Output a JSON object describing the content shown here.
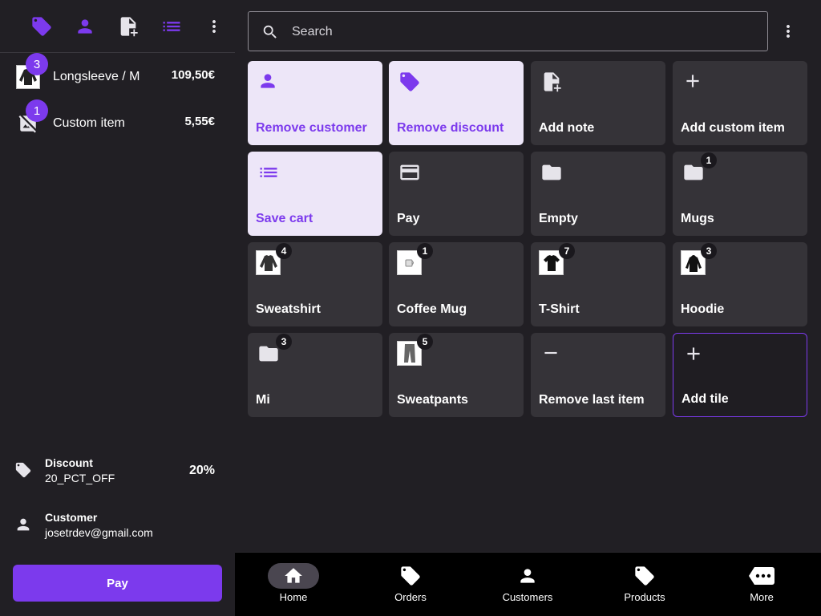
{
  "colors": {
    "accent": "#7c3aed",
    "tile": "#353338",
    "tile_light": "#ede6f8",
    "background": "#211f24"
  },
  "toolbar": {
    "icons": [
      "tag-icon",
      "person-icon",
      "note-add-icon",
      "list-icon",
      "more-vert-icon"
    ]
  },
  "cart": {
    "items": [
      {
        "name": "Longsleeve / M",
        "price": "109,50€",
        "qty": "3",
        "icon": "longsleeve-thumbnail"
      },
      {
        "name": "Custom item",
        "price": "5,55€",
        "qty": "1",
        "icon": "no-image-icon"
      }
    ],
    "discount": {
      "title": "Discount",
      "code": "20_PCT_OFF",
      "value": "20%"
    },
    "customer": {
      "title": "Customer",
      "email": "josetrdev@gmail.com"
    },
    "pay_label": "Pay"
  },
  "search": {
    "placeholder": "Search"
  },
  "tiles": [
    {
      "label": "Remove customer",
      "icon": "person-icon",
      "style": "light"
    },
    {
      "label": "Remove discount",
      "icon": "tag-icon",
      "style": "light"
    },
    {
      "label": "Add note",
      "icon": "note-add-icon",
      "style": "dark"
    },
    {
      "label": "Add custom item",
      "icon": "plus-icon",
      "style": "dark"
    },
    {
      "label": "Save cart",
      "icon": "list-icon",
      "style": "light"
    },
    {
      "label": "Pay",
      "icon": "credit-card-icon",
      "style": "dark"
    },
    {
      "label": "Empty",
      "icon": "folder-icon",
      "style": "dark"
    },
    {
      "label": "Mugs",
      "icon": "folder-icon",
      "style": "dark",
      "badge": "1"
    },
    {
      "label": "Sweatshirt",
      "icon": "sweatshirt-thumbnail",
      "style": "dark",
      "badge": "4"
    },
    {
      "label": "Coffee Mug",
      "icon": "mug-thumbnail",
      "style": "dark",
      "badge": "1"
    },
    {
      "label": "T-Shirt",
      "icon": "tshirt-thumbnail",
      "style": "dark",
      "badge": "7"
    },
    {
      "label": "Hoodie",
      "icon": "hoodie-thumbnail",
      "style": "dark",
      "badge": "3"
    },
    {
      "label": "Mi",
      "icon": "folder-icon",
      "style": "dark",
      "badge": "3"
    },
    {
      "label": "Sweatpants",
      "icon": "sweatpants-thumbnail",
      "style": "dark",
      "badge": "5"
    },
    {
      "label": "Remove last item",
      "icon": "minus-icon",
      "style": "dark"
    },
    {
      "label": "Add tile",
      "icon": "plus-icon",
      "style": "outlined"
    }
  ],
  "nav": [
    {
      "label": "Home",
      "icon": "home-icon",
      "active": true
    },
    {
      "label": "Orders",
      "icon": "tag-icon",
      "active": false
    },
    {
      "label": "Customers",
      "icon": "person-icon",
      "active": false
    },
    {
      "label": "Products",
      "icon": "tag-icon",
      "active": false
    },
    {
      "label": "More",
      "icon": "more-horiz-icon",
      "active": false
    }
  ]
}
